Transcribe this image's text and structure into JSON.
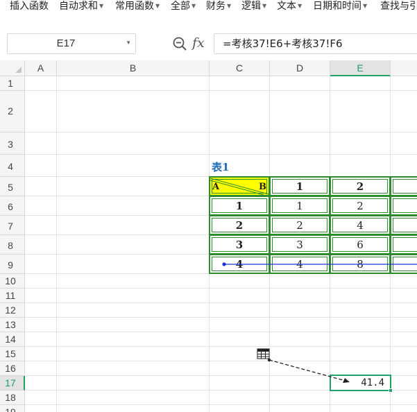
{
  "ribbon": {
    "items": [
      {
        "label": "插入函数",
        "caret": false
      },
      {
        "label": "自动求和",
        "caret": true
      },
      {
        "label": "常用函数",
        "caret": true
      },
      {
        "label": "全部",
        "caret": true
      },
      {
        "label": "财务",
        "caret": true
      },
      {
        "label": "逻辑",
        "caret": true
      },
      {
        "label": "文本",
        "caret": true
      },
      {
        "label": "日期和时间",
        "caret": true
      },
      {
        "label": "查找与引",
        "caret": false
      }
    ]
  },
  "formula_bar": {
    "cell_ref": "E17",
    "formula": "=考核37!E6+考核37!F6"
  },
  "grid": {
    "columns": [
      "A",
      "B",
      "C",
      "D",
      "E"
    ],
    "selected_column": "E",
    "rows": [
      "1",
      "2",
      "3",
      "4",
      "5",
      "6",
      "7",
      "8",
      "9",
      "10",
      "11",
      "12",
      "13",
      "14",
      "15",
      "16",
      "17",
      "18",
      "19"
    ],
    "selected_row": "17"
  },
  "table": {
    "title": "表1",
    "header_left": "A",
    "header_right": "B",
    "col_headers": [
      "1",
      "2"
    ],
    "row_headers": [
      "1",
      "2",
      "3",
      "4"
    ],
    "values": [
      [
        "1",
        "2"
      ],
      [
        "2",
        "4"
      ],
      [
        "3",
        "6"
      ],
      [
        "4",
        "8"
      ]
    ]
  },
  "selected_cell": {
    "value": "41.4"
  },
  "icons": {
    "zoom": "zoom-formula-icon",
    "fx": "fx-icon",
    "trace": "table-precedent-icon"
  },
  "colors": {
    "accent": "#21a366",
    "table_border": "#2e8b2e",
    "title": "#1f6fb6",
    "trace_line": "#2233dd",
    "header_fill": "#ffff00"
  }
}
